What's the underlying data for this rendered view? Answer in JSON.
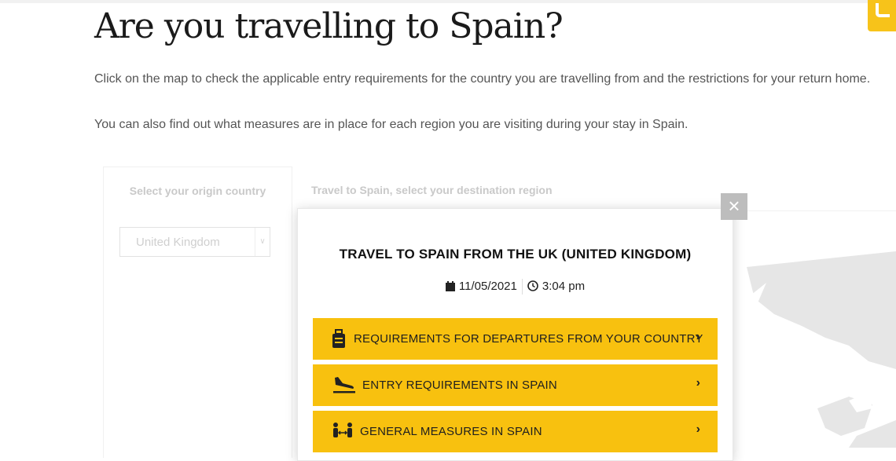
{
  "page": {
    "title": "Are you travelling to Spain?",
    "intro": "Click on the map to check the applicable entry requirements for the country you are travelling from and the restrictions for your return home.",
    "intro2": "You can also find out what measures are in place for each region you are visiting during your stay in Spain."
  },
  "tool": {
    "origin_label": "Select your origin country",
    "origin_value": "United Kingdom",
    "destination_label": "Travel to Spain, select your destination region"
  },
  "modal": {
    "close": "×",
    "title": "TRAVEL TO SPAIN FROM THE UK (UNITED KINGDOM)",
    "date": "11/05/2021",
    "time": "3:04 pm",
    "options": [
      {
        "label": "REQUIREMENTS FOR DEPARTURES FROM YOUR COUNTRY",
        "icon": "luggage-icon"
      },
      {
        "label": "ENTRY REQUIREMENTS IN SPAIN",
        "icon": "plane-landing-icon"
      },
      {
        "label": "GENERAL MEASURES IN SPAIN",
        "icon": "social-distance-icon"
      }
    ],
    "chevron": "›"
  },
  "colors": {
    "accent": "#f8c10f",
    "close_bg": "#bdbdbd",
    "muted_text": "#c9c9c9"
  }
}
